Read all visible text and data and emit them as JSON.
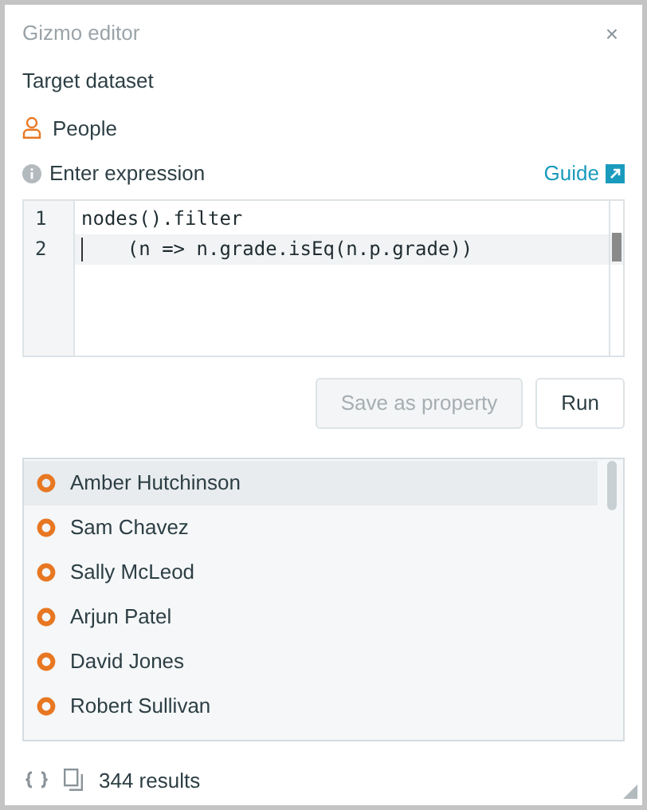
{
  "window": {
    "title": "Gizmo editor",
    "close": "×"
  },
  "target": {
    "label": "Target dataset",
    "dataset": "People"
  },
  "expression": {
    "label": "Enter expression",
    "guide": "Guide"
  },
  "editor": {
    "lines": [
      {
        "number": "1",
        "code": "nodes().filter",
        "active": false
      },
      {
        "number": "2",
        "code": "    (n => n.grade.isEq(n.p.grade))",
        "active": true
      }
    ]
  },
  "buttons": [
    {
      "label": "Save as property",
      "disabled": true
    },
    {
      "label": "Run",
      "disabled": false
    }
  ],
  "results": [
    {
      "name": "Amber Hutchinson",
      "selected": true
    },
    {
      "name": "Sam Chavez",
      "selected": false
    },
    {
      "name": "Sally McLeod",
      "selected": false
    },
    {
      "name": "Arjun Patel",
      "selected": false
    },
    {
      "name": "David Jones",
      "selected": false
    },
    {
      "name": "Robert Sullivan",
      "selected": false
    }
  ],
  "footer": {
    "count": "344 results"
  }
}
